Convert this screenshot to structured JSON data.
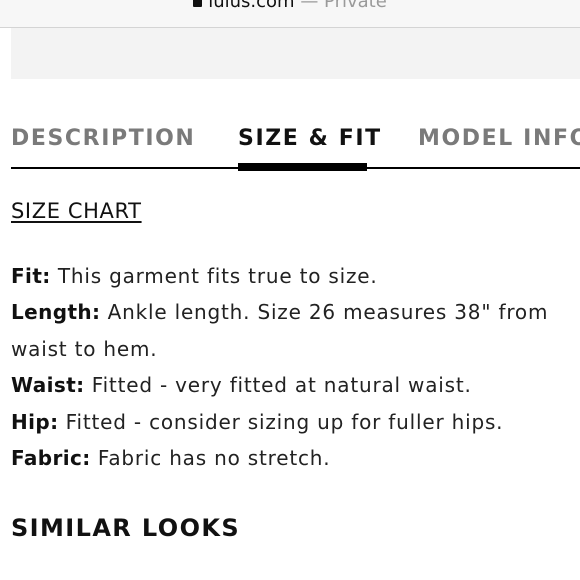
{
  "browser": {
    "domain": "lulus.com",
    "privacy": "— Private",
    "lock_icon": "lock-icon"
  },
  "tabs": [
    {
      "label": "DESCRIPTION",
      "active": false
    },
    {
      "label": "SIZE & FIT",
      "active": true
    },
    {
      "label": "MODEL INFO",
      "active": false
    }
  ],
  "size_chart_link": "SIZE CHART",
  "fit_details": [
    {
      "label": "Fit:",
      "text": " This garment fits true to size."
    },
    {
      "label": "Length:",
      "text": " Ankle length. Size 26 measures 38\" from"
    },
    {
      "label": "",
      "text": "waist to hem."
    },
    {
      "label": "Waist:",
      "text": " Fitted - very fitted at natural waist."
    },
    {
      "label": "Hip:",
      "text": " Fitted - consider sizing up for fuller hips."
    },
    {
      "label": "Fabric:",
      "text": " Fabric has no stretch."
    }
  ],
  "similar_heading": "SIMILAR LOOKS",
  "colors": {
    "active_tab": "#111111",
    "inactive_tab": "#7a7a7a",
    "private_text": "#9a9a9a"
  }
}
